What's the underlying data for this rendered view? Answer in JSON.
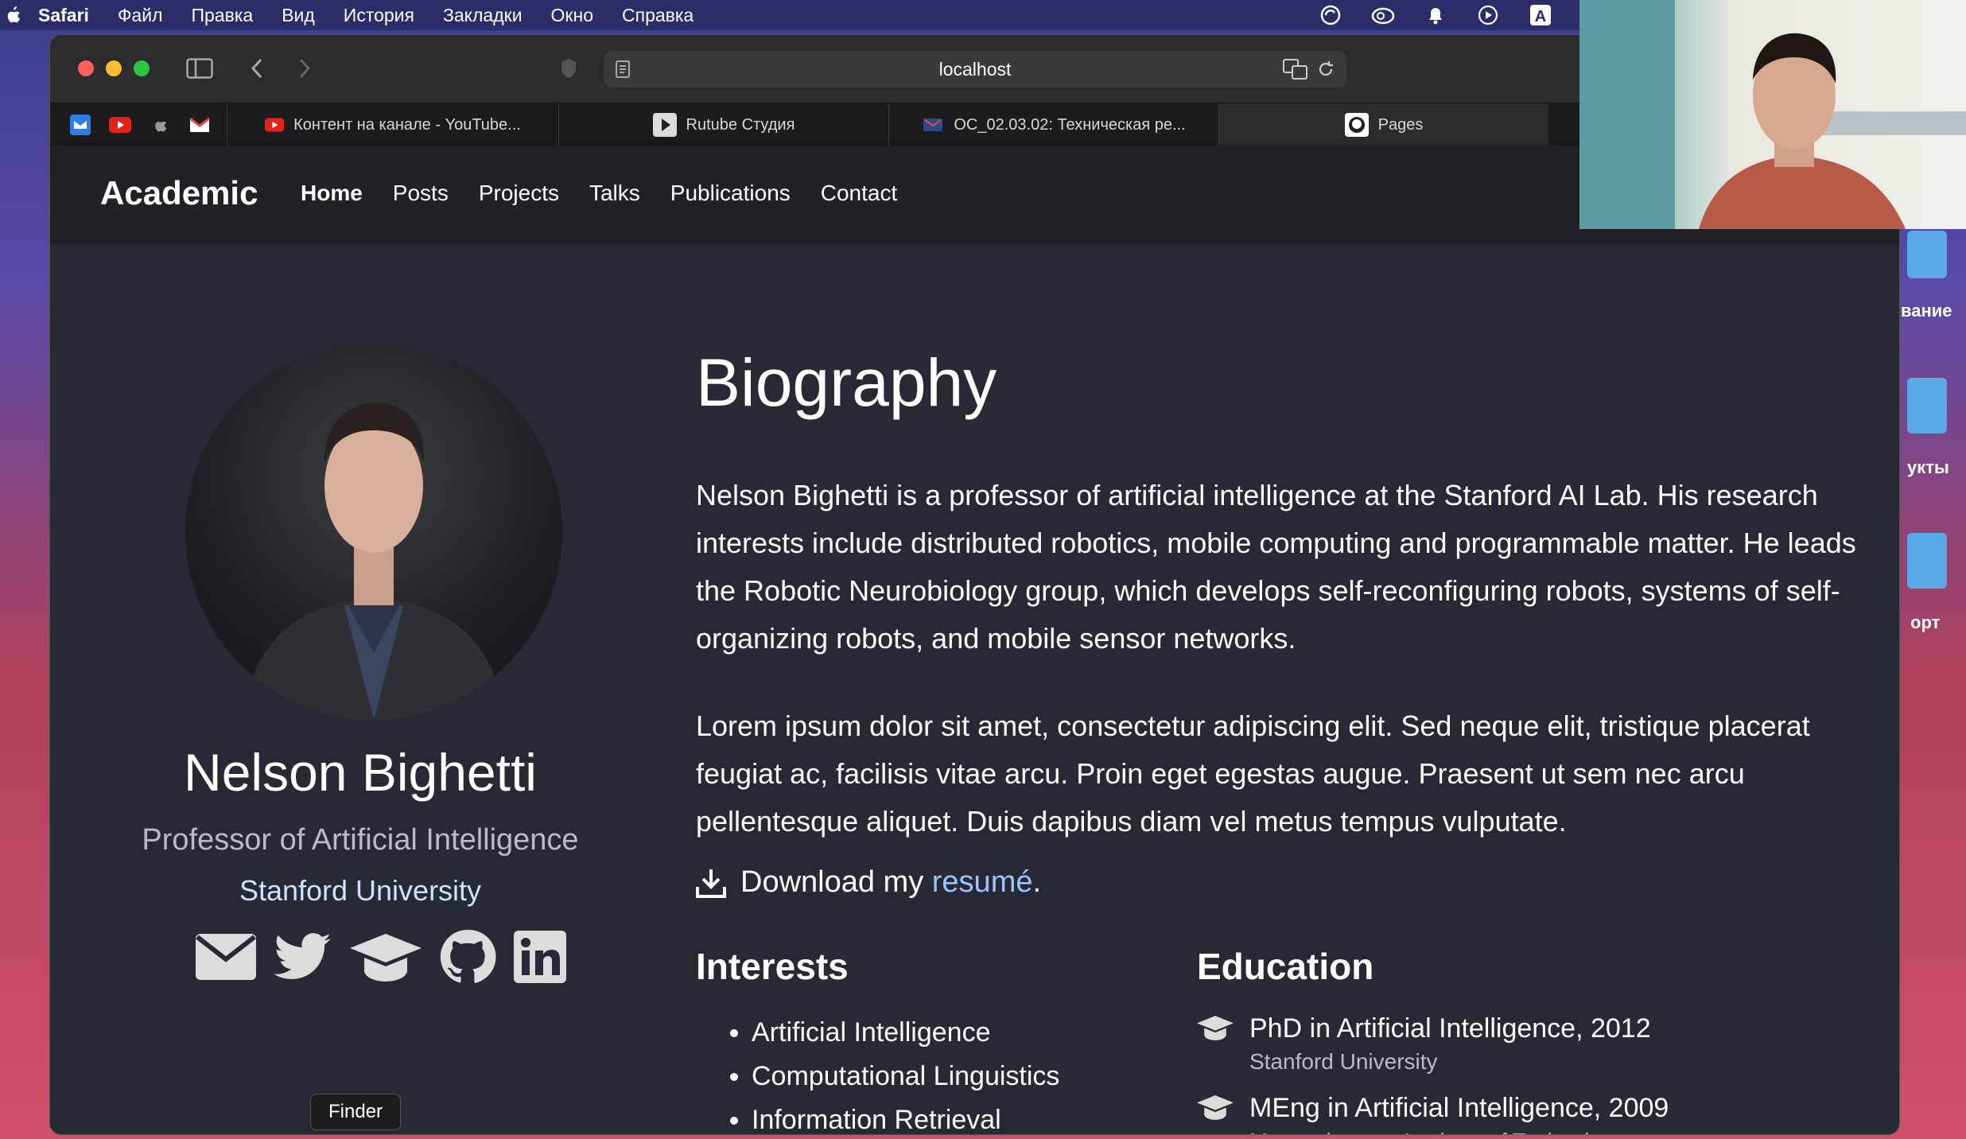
{
  "menubar": {
    "items": [
      "Safari",
      "Файл",
      "Правка",
      "Вид",
      "История",
      "Закладки",
      "Окно",
      "Справка"
    ]
  },
  "browser": {
    "url": "localhost",
    "tabs": [
      {
        "label": "Контент на канале - YouTube...",
        "icon": "youtube-icon"
      },
      {
        "label": "Rutube Студия",
        "icon": "rutube-icon"
      },
      {
        "label": "ОС_02.03.02: Техническая ре...",
        "icon": "doc-icon"
      },
      {
        "label": "Pages",
        "icon": "github-icon"
      }
    ]
  },
  "site": {
    "brand": "Academic",
    "nav": [
      "Home",
      "Posts",
      "Projects",
      "Talks",
      "Publications",
      "Contact"
    ],
    "profile": {
      "name": "Nelson Bighetti",
      "role": "Professor of Artificial Intelligence",
      "organization": "Stanford University"
    },
    "biography": {
      "title": "Biography",
      "paragraph1": "Nelson Bighetti is a professor of artificial intelligence at the Stanford AI Lab. His research interests include distributed robotics, mobile computing and programmable matter. He leads the Robotic Neurobiology group, which develops self-reconfiguring robots, systems of self-organizing robots, and mobile sensor networks.",
      "paragraph2": "Lorem ipsum dolor sit amet, consectetur adipiscing elit. Sed neque elit, tristique placerat feugiat ac, facilisis vitae arcu. Proin eget egestas augue. Praesent ut sem nec arcu pellentesque aliquet. Duis dapibus diam vel metus tempus vulputate.",
      "download_prefix": "Download my ",
      "download_link": "resumé",
      "download_suffix": "."
    },
    "interests": {
      "title": "Interests",
      "items": [
        "Artificial Intelligence",
        "Computational Linguistics",
        "Information Retrieval"
      ]
    },
    "education": {
      "title": "Education",
      "items": [
        {
          "degree": "PhD in Artificial Intelligence, 2012",
          "institution": "Stanford University"
        },
        {
          "degree": "MEng in Artificial Intelligence, 2009",
          "institution": "Massachusetts Institute of Technology"
        }
      ]
    }
  },
  "tooltip": "Finder",
  "side_labels": [
    "вание",
    "укты",
    "орт"
  ],
  "colors": {
    "link": "#9cc3ff",
    "background": "#272a34",
    "navbar": "#202226"
  }
}
